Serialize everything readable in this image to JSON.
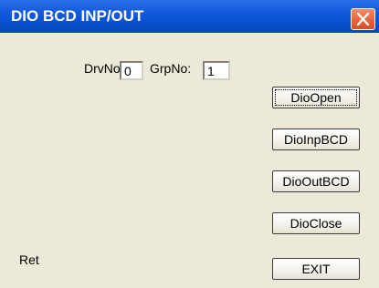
{
  "window": {
    "title": "DIO BCD INP/OUT",
    "title_bar_color": "#0b55d8",
    "close_button_color": "#e86a43",
    "close_icon": "close-icon"
  },
  "form": {
    "drv_label": "DrvNo:",
    "drv_value": "0",
    "grp_label": "GrpNo:",
    "grp_value": "1"
  },
  "buttons": {
    "dio_open": "DioOpen",
    "dio_inp_bcd": "DioInpBCD",
    "dio_out_bcd": "DioOutBCD",
    "dio_close": "DioClose",
    "exit": "EXIT"
  },
  "status": {
    "ret_label": "Ret"
  }
}
